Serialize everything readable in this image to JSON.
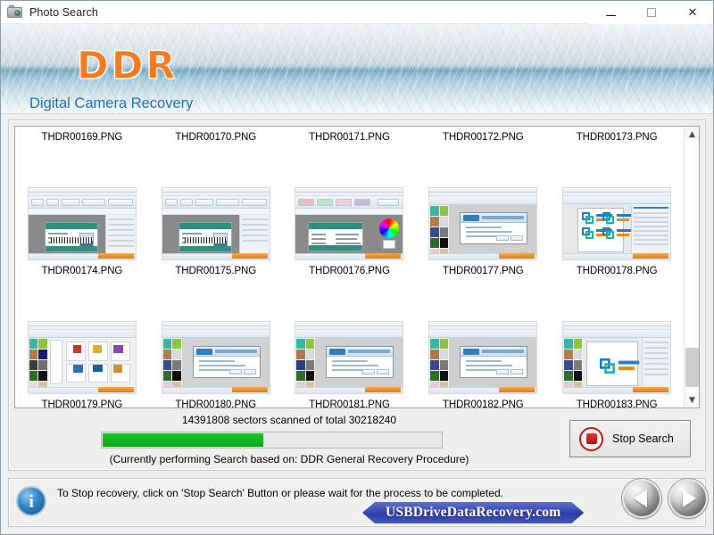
{
  "window": {
    "title": "Photo Search",
    "icon": "camera-icon",
    "controls": {
      "minimize": "minimize-icon",
      "maximize": "maximize-icon",
      "close": "close-icon"
    }
  },
  "banner": {
    "logo": "DDR",
    "subtitle": "Digital Camera Recovery",
    "logo_color": "#f47b20",
    "subtitle_color": "#1f6fb5"
  },
  "file_grid": {
    "rows": [
      {
        "cells": [
          {
            "name": "THDR00169.PNG",
            "thumb": "none"
          },
          {
            "name": "THDR00170.PNG",
            "thumb": "none"
          },
          {
            "name": "THDR00171.PNG",
            "thumb": "none"
          },
          {
            "name": "THDR00172.PNG",
            "thumb": "none"
          },
          {
            "name": "THDR00173.PNG",
            "thumb": "none"
          }
        ]
      },
      {
        "cells": [
          {
            "name": "THDR00174.PNG",
            "thumb": "idcard-designer"
          },
          {
            "name": "THDR00175.PNG",
            "thumb": "idcard-designer"
          },
          {
            "name": "THDR00176.PNG",
            "thumb": "idcard-colorwheel"
          },
          {
            "name": "THDR00177.PNG",
            "thumb": "wizard-dialog"
          },
          {
            "name": "THDR00178.PNG",
            "thumb": "batch-logo-sheet"
          }
        ]
      },
      {
        "cells": [
          {
            "name": "THDR00179.PNG",
            "thumb": "template-gallery"
          },
          {
            "name": "THDR00180.PNG",
            "thumb": "wizard-dialog"
          },
          {
            "name": "THDR00181.PNG",
            "thumb": "wizard-dialog"
          },
          {
            "name": "THDR00182.PNG",
            "thumb": "wizard-dialog"
          },
          {
            "name": "THDR00183.PNG",
            "thumb": "logo-page"
          }
        ]
      }
    ],
    "scrollbar": {
      "up_arrow": "chevron-up-icon",
      "down_arrow": "chevron-down-icon"
    }
  },
  "progress": {
    "scanned_text": "14391808 sectors scanned of total 30218240",
    "sectors_scanned": 14391808,
    "sectors_total": 30218240,
    "percent": 47.6,
    "bar_color": "#0ca717",
    "procedure_text": "(Currently performing Search based on:  DDR General Recovery Procedure)"
  },
  "stop_button": {
    "label": "Stop Search",
    "icon": "stop-square-icon"
  },
  "footer": {
    "info_icon": "info-icon",
    "info_glyph": "i",
    "message": "To Stop recovery, click on 'Stop Search' Button or please wait for the process to be completed.",
    "brand_banner": "USBDriveDataRecovery.com",
    "brand_color": "#2f3ea6",
    "nav_back": "previous-arrow-icon",
    "nav_next": "next-arrow-icon"
  }
}
